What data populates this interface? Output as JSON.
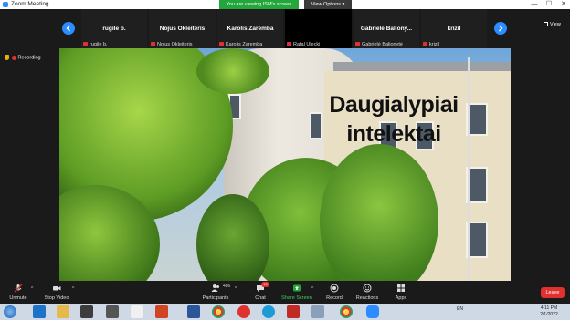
{
  "window": {
    "title": "Zoom Meeting",
    "minimize": "—",
    "maximize": "☐",
    "close": "✕"
  },
  "banner": {
    "viewing": "You are viewing ISM's screen",
    "view_options": "View Options ▾"
  },
  "strip": {
    "participants": [
      {
        "name": "rugile b.",
        "label": "rugile b."
      },
      {
        "name": "Nojus Okleiteris",
        "label": "Nojus Okleiteris"
      },
      {
        "name": "Karolis Zaremba",
        "label": "Karolis Zaremba"
      },
      {
        "name": "",
        "label": "Rafal Ulecki"
      },
      {
        "name": "Gabrielė  Baliony...",
        "label": "Gabrielė Balionytė"
      },
      {
        "name": "krizil",
        "label": "krizil"
      }
    ],
    "view_label": "View"
  },
  "recording": {
    "label": "Recording"
  },
  "slide": {
    "title_line1": "Daugialypiai",
    "title_line2": "intelektai"
  },
  "toolbar": {
    "unmute": "Unmute",
    "stop_video": "Stop Video",
    "participants": "Participants",
    "participants_count": "486",
    "chat": "Chat",
    "chat_badge": "10",
    "share_screen": "Share Screen",
    "record": "Record",
    "reactions": "Reactions",
    "apps": "Apps",
    "leave": "Leave"
  },
  "taskbar": {
    "lang": "EN",
    "time": "4:11 PM",
    "date": "2/1/2022"
  },
  "colors": {
    "accent": "#2d8cff",
    "leave": "#e0312f",
    "share_green": "#23a63b"
  }
}
